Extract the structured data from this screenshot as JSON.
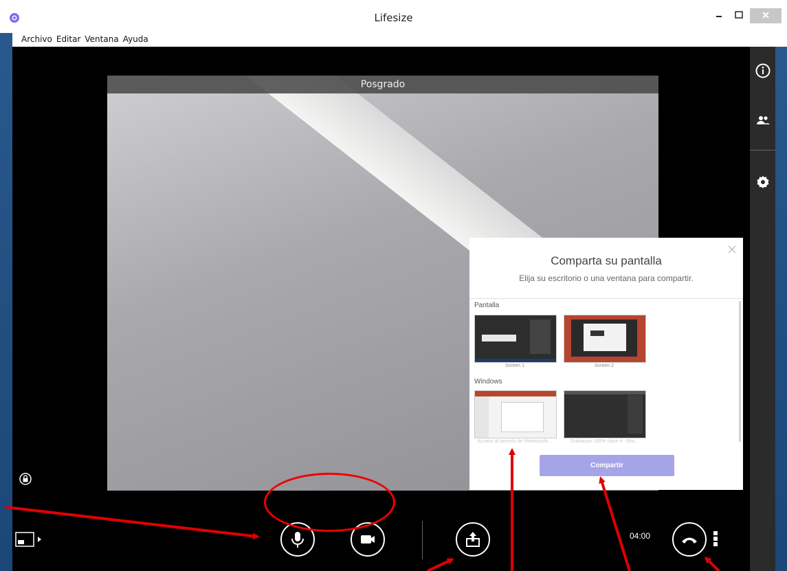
{
  "window": {
    "title": "Lifesize",
    "menu": [
      "Archivo",
      "Editar",
      "Ventana",
      "Ayuda"
    ]
  },
  "video": {
    "participant_label": "Posgrado"
  },
  "share_dialog": {
    "title": "Comparta su pantalla",
    "subtitle": "Elija su escritorio o una ventana para compartir.",
    "sections": [
      {
        "label": "Pantalla",
        "items": [
          {
            "caption": "Screen 1"
          },
          {
            "caption": "Screen 2"
          }
        ]
      },
      {
        "label": "Windows",
        "items": [
          {
            "caption": "Acceso al servicio de Videoconfe..."
          },
          {
            "caption": "Grabacion 100% clase 4 - Bra..."
          }
        ]
      }
    ],
    "share_button": "Compartir"
  },
  "controls": {
    "timer": "04:00"
  },
  "icons": [
    "app-logo-icon",
    "minimize-icon",
    "maximize-icon",
    "close-icon",
    "info-icon",
    "participants-icon",
    "settings-icon",
    "lock-icon",
    "layout-icon",
    "microphone-icon",
    "camera-icon",
    "share-screen-icon",
    "hang-up-icon",
    "more-options-icon"
  ],
  "colors": {
    "share_button": "#a6a4e8",
    "annotation": "#e00000",
    "desktop_border": "#1d4a7a"
  }
}
